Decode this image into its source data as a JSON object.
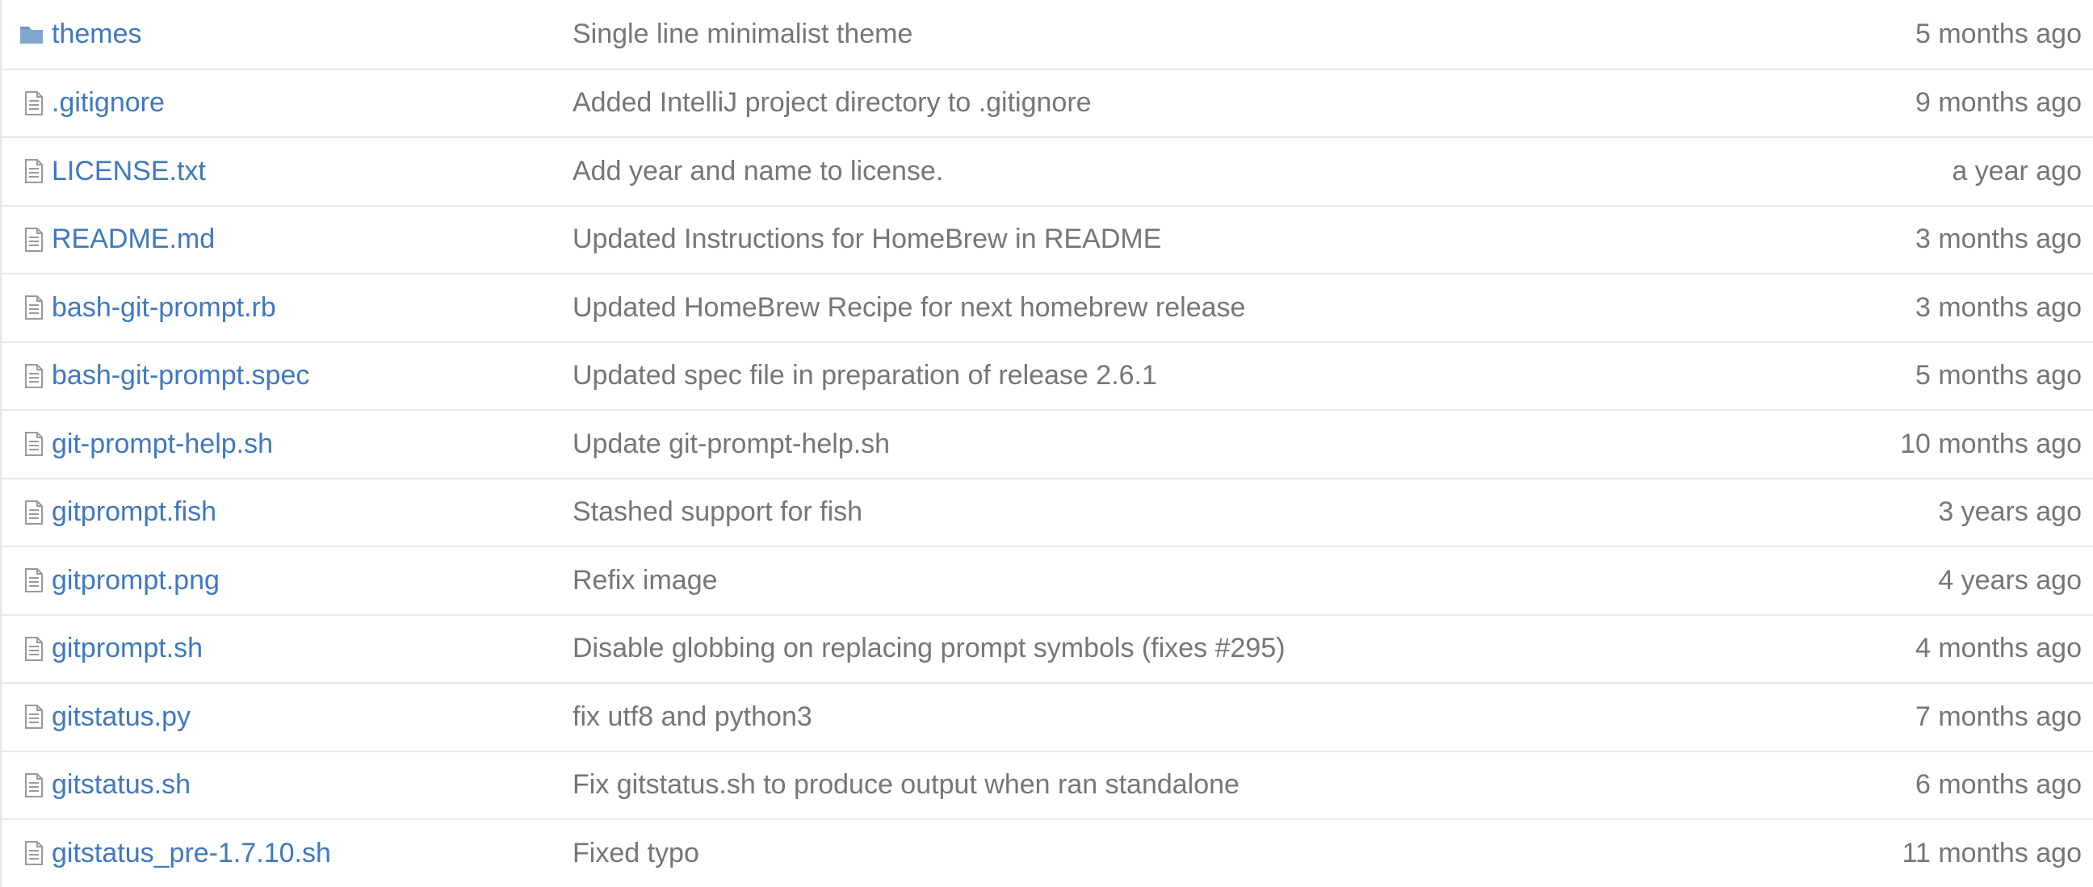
{
  "files": [
    {
      "icon": "folder-icon",
      "name": "themes",
      "message": "Single line minimalist theme",
      "age": "5 months ago"
    },
    {
      "icon": "file-icon",
      "name": ".gitignore",
      "message": "Added IntelliJ project directory to .gitignore",
      "age": "9 months ago"
    },
    {
      "icon": "file-icon",
      "name": "LICENSE.txt",
      "message": "Add year and name to license.",
      "age": "a year ago"
    },
    {
      "icon": "file-icon",
      "name": "README.md",
      "message": "Updated Instructions for HomeBrew in README",
      "age": "3 months ago"
    },
    {
      "icon": "file-icon",
      "name": "bash-git-prompt.rb",
      "message": "Updated HomeBrew Recipe for next homebrew release",
      "age": "3 months ago"
    },
    {
      "icon": "file-icon",
      "name": "bash-git-prompt.spec",
      "message": "Updated spec file in preparation of release 2.6.1",
      "age": "5 months ago"
    },
    {
      "icon": "file-icon",
      "name": "git-prompt-help.sh",
      "message": "Update git-prompt-help.sh",
      "age": "10 months ago"
    },
    {
      "icon": "file-icon",
      "name": "gitprompt.fish",
      "message": "Stashed support for fish",
      "age": "3 years ago"
    },
    {
      "icon": "file-icon",
      "name": "gitprompt.png",
      "message": "Refix image",
      "age": "4 years ago"
    },
    {
      "icon": "file-icon",
      "name": "gitprompt.sh",
      "message": "Disable globbing on replacing prompt symbols (fixes #295)",
      "age": "4 months ago"
    },
    {
      "icon": "file-icon",
      "name": "gitstatus.py",
      "message": "fix utf8 and python3",
      "age": "7 months ago"
    },
    {
      "icon": "file-icon",
      "name": "gitstatus.sh",
      "message": "Fix gitstatus.sh to produce output when ran standalone",
      "age": "6 months ago"
    },
    {
      "icon": "file-icon",
      "name": "gitstatus_pre-1.7.10.sh",
      "message": "Fixed typo",
      "age": "11 months ago"
    }
  ],
  "colors": {
    "link": "#4078c0",
    "muted_text": "#767676",
    "folder_icon": "#80a6cd",
    "file_icon": "#9a9a9a",
    "row_border": "#e8e8e8"
  }
}
